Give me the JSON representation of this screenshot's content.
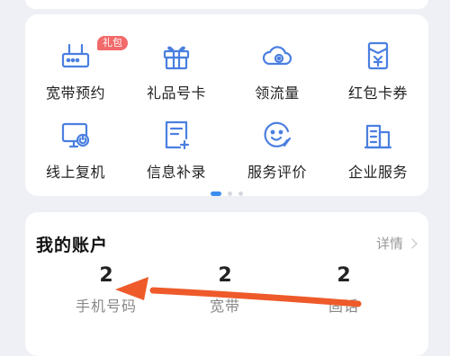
{
  "services": {
    "badge": "礼包",
    "items": [
      {
        "label": "宽带预约",
        "icon": "router-icon"
      },
      {
        "label": "礼品号卡",
        "icon": "gift-icon"
      },
      {
        "label": "领流量",
        "icon": "cloud-data-icon"
      },
      {
        "label": "红包卡券",
        "icon": "red-envelope-icon"
      },
      {
        "label": "线上复机",
        "icon": "monitor-power-icon"
      },
      {
        "label": "信息补录",
        "icon": "document-add-icon"
      },
      {
        "label": "服务评价",
        "icon": "smiley-edit-icon"
      },
      {
        "label": "企业服务",
        "icon": "building-icon"
      }
    ],
    "pager": {
      "pages": 3,
      "active": 0
    }
  },
  "account": {
    "title": "我的账户",
    "detail_label": "详情",
    "stats": [
      {
        "value": "2",
        "caption": "手机号码"
      },
      {
        "value": "2",
        "caption": "宽带"
      },
      {
        "value": "2",
        "caption": "固话"
      }
    ]
  },
  "colors": {
    "icon_blue": "#4a7fe0",
    "badge_red": "#f26a6a",
    "arrow_orange": "#ee5a2a",
    "pager_active": "#3c8cf0"
  }
}
